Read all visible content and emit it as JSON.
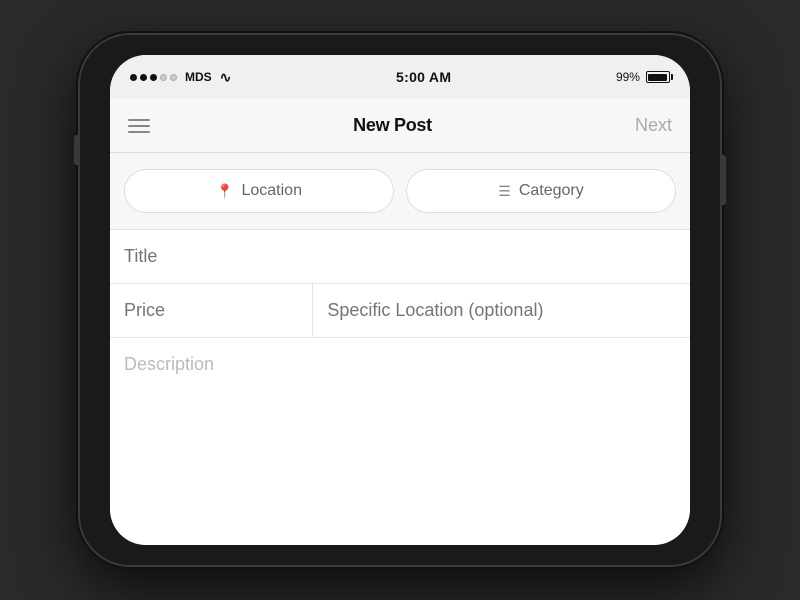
{
  "phone": {
    "statusBar": {
      "carrier": "MDS",
      "time": "5:00 AM",
      "battery": "99%"
    },
    "navBar": {
      "title": "New Post",
      "nextLabel": "Next",
      "menuAriaLabel": "Menu"
    },
    "buttons": {
      "locationLabel": "Location",
      "categoryLabel": "Category"
    },
    "form": {
      "titlePlaceholder": "Title",
      "pricePlaceholder": "Price",
      "specificLocationPlaceholder": "Specific Location (optional)",
      "descriptionPlaceholder": "Description"
    }
  }
}
